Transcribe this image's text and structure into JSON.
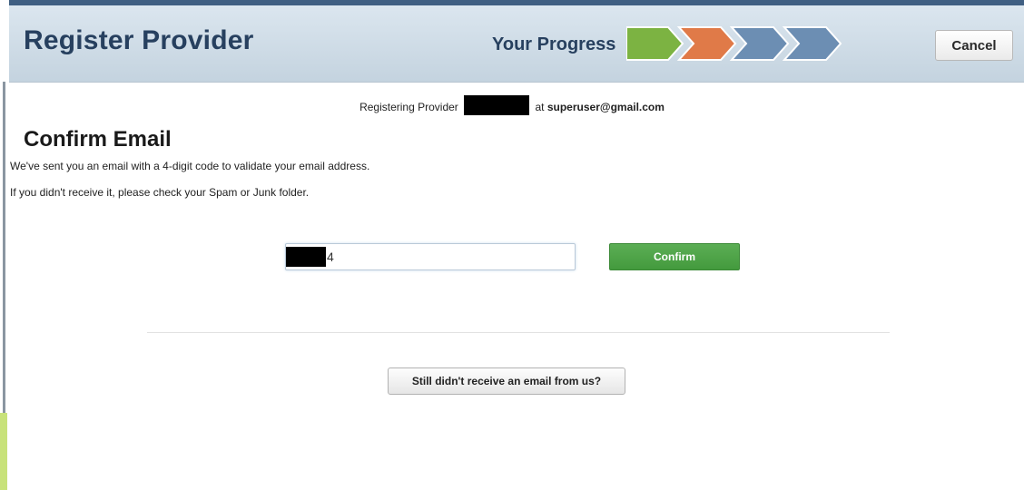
{
  "header": {
    "title": "Register Provider",
    "progress_label": "Your Progress",
    "progress_steps": [
      {
        "state": "complete",
        "color": "#7cb342"
      },
      {
        "state": "current",
        "color": "#e07a48"
      },
      {
        "state": "pending",
        "color": "#6c8eb3"
      },
      {
        "state": "pending",
        "color": "#6c8eb3"
      }
    ],
    "cancel_label": "Cancel"
  },
  "registration": {
    "prefix": "Registering Provider",
    "connector": "at",
    "email": "superuser@gmail.com"
  },
  "confirm": {
    "heading": "Confirm Email",
    "line1": "We've sent you an email with a 4-digit code to validate your email address.",
    "line2": "If you didn't receive it, please check your Spam or Junk folder.",
    "code_visible_digit": "4",
    "confirm_label": "Confirm",
    "resend_label": "Still didn't receive an email from us?"
  },
  "colors": {
    "header_title": "#27405f",
    "confirm_green": "#4aa044"
  }
}
